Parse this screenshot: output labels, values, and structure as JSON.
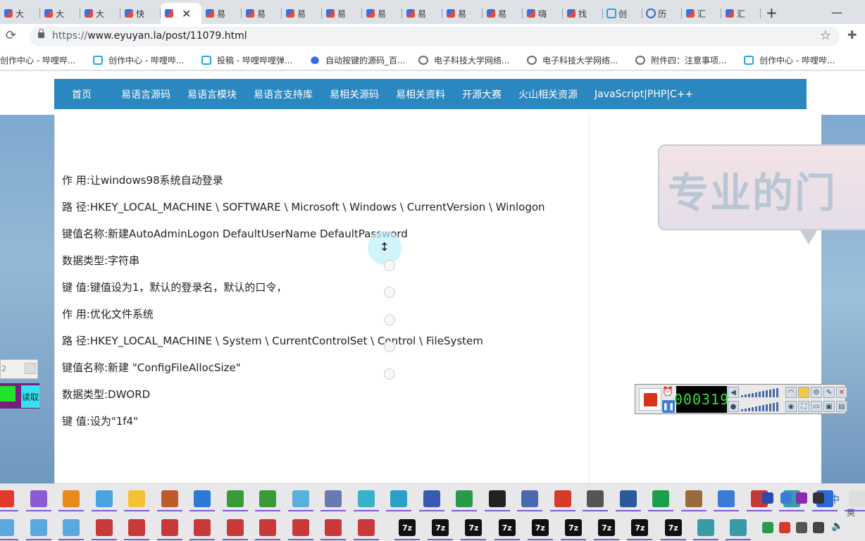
{
  "browser": {
    "tabs": [
      {
        "title": "大",
        "favicon": "kite-icon"
      },
      {
        "title": "大",
        "favicon": "kite-icon"
      },
      {
        "title": "大",
        "favicon": "kite-icon"
      },
      {
        "title": "快",
        "favicon": "kite-icon"
      },
      {
        "title": "",
        "favicon": "kite-icon",
        "active": true
      },
      {
        "title": "易",
        "favicon": "kite-icon"
      },
      {
        "title": "易",
        "favicon": "kite-icon"
      },
      {
        "title": "易",
        "favicon": "kite-icon"
      },
      {
        "title": "易",
        "favicon": "kite-icon"
      },
      {
        "title": "易",
        "favicon": "kite-icon"
      },
      {
        "title": "易",
        "favicon": "kite-icon"
      },
      {
        "title": "易",
        "favicon": "kite-icon"
      },
      {
        "title": "易",
        "favicon": "kite-icon"
      },
      {
        "title": "嗨",
        "favicon": "kite-icon"
      },
      {
        "title": "找",
        "favicon": "kite-icon"
      },
      {
        "title": "创",
        "favicon": "bilibili-icon"
      },
      {
        "title": "历",
        "favicon": "history-icon"
      },
      {
        "title": "汇",
        "favicon": "kite-icon"
      },
      {
        "title": "汇",
        "favicon": "kite-icon"
      }
    ],
    "close_glyph": "✕",
    "new_tab_glyph": "+",
    "url_protocol": "https://",
    "url_rest": "www.eyuyan.la/post/11079.html",
    "bookmarks": [
      {
        "label": "创作中心 - 哔哩哔...",
        "icon": "bilibili-icon"
      },
      {
        "label": "创作中心 - 哔哩哔...",
        "icon": "bilibili-icon"
      },
      {
        "label": "投稿 - 哔哩哔哩弹...",
        "icon": "bilibili-icon"
      },
      {
        "label": "自动按键的源码_百...",
        "icon": "baidu-paw-icon"
      },
      {
        "label": "电子科技大学网络...",
        "icon": "globe-icon"
      },
      {
        "label": "电子科技大学网络...",
        "icon": "globe-icon"
      },
      {
        "label": "附件四：注意事项...",
        "icon": "globe-icon"
      },
      {
        "label": "创作中心 - 哔哩哔...",
        "icon": "bilibili-icon"
      }
    ]
  },
  "site": {
    "nav": [
      "首页",
      "易语言源码",
      "易语言模块",
      "易语言支持库",
      "易相关源码",
      "易相关资料",
      "开源大赛",
      "火山相关资源",
      "JavaScript|PHP|C++"
    ],
    "article_lines": [
      "作 用:让windows98系统自动登录",
      "路 径:HKEY_LOCAL_MACHINE \\ SOFTWARE \\ Microsoft \\ Windows \\ CurrentVersion \\ Winlogon",
      "键值名称:新建AutoAdminLogon DefaultUserName DefaultPassword",
      "数据类型:字符串",
      "键 值:键值设为1，默认的登录名，默认的口令，",
      "作 用:优化文件系统",
      "路 径:HKEY_LOCAL_MACHINE \\ System \\ CurrentControlSet \\ Control \\ FileSystem",
      "键值名称:新建 \"ConfigFileAllocSize\"",
      "数据类型:DWORD",
      "键 值:设为\"1f4\""
    ],
    "ad_text": "专业的门",
    "colors": {
      "nav_bg": "#2a87bf",
      "nav_text": "#ffffff"
    }
  },
  "widgets": {
    "left_input_value": "2",
    "left_green_label": "",
    "left_read_button": "读取",
    "recorder_time": "000319"
  },
  "taskbar": {
    "dark_icon_label": "7z",
    "tray_ime": "中",
    "tray_lang": "英"
  }
}
